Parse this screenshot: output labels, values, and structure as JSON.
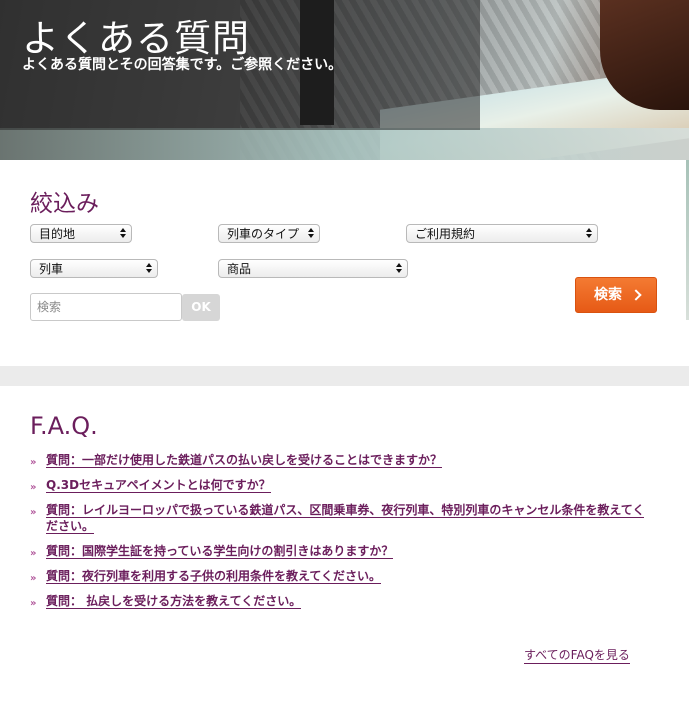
{
  "hero": {
    "title": "よくある質問",
    "subtitle": "よくある質問とその回答集です。ご参照ください。"
  },
  "filter": {
    "title": "絞込み",
    "selects": {
      "destination": "目的地",
      "train_type": "列車のタイプ",
      "terms": "ご利用規約",
      "train": "列車",
      "product": "商品"
    },
    "search_placeholder": "検索",
    "ok_label": "OK",
    "search_button_label": "検索"
  },
  "faq": {
    "title": "F.A.Q.",
    "items": [
      "質問：一部だけ使用した鉄道パスの払い戻しを受けることはできますか？",
      "Q.3Dセキュアペイメントとは何ですか？",
      "質問：レイルヨーロッパで扱っている鉄道パス、区間乗車券、夜行列車、特別列車のキャンセル条件を教えてください。",
      "質問：国際学生証を持っている学生向けの割引きはありますか？",
      "質問：夜行列車を利用する子供の利用条件を教えてください。",
      "質問： 払戻しを受ける方法を教えてください。"
    ],
    "bullet": "»",
    "all_link": "すべてのFAQを見る"
  },
  "colors": {
    "accent": "#6b1e5c",
    "search_button": "#ee6a22",
    "divider": "#ebebeb"
  }
}
